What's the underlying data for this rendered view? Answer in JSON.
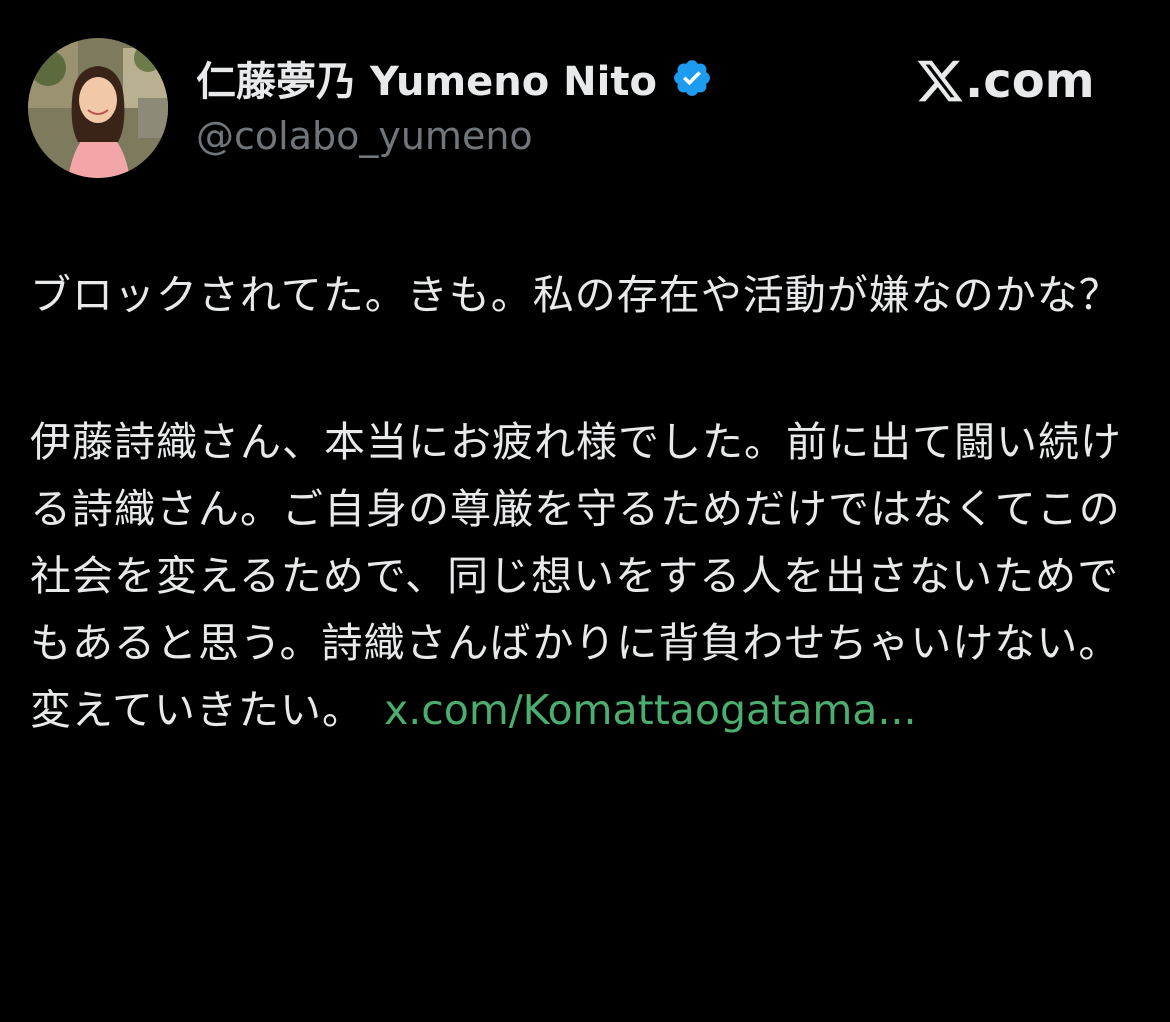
{
  "author": {
    "display_name": "仁藤夢乃 Yumeno Nito",
    "handle": "@colabo_yumeno",
    "verified": true,
    "verified_icon": "verified-badge-icon",
    "verified_color": "#1d9bf0"
  },
  "brand": {
    "logo_icon": "x-logo-icon",
    "text": ".com"
  },
  "tweet": {
    "paragraph_1": "ブロックされてた。きも。私の存在や活動が嫌なのかな？",
    "paragraph_2": "伊藤詩織さん、本当にお疲れ様でした。前に出て闘い続ける詩織さん。ご自身の尊厳を守るためだけではなくてこの社会を変えるためで、同じ想いをする人を出さないためでもあると思う。詩織さんばかりに背負わせちゃいけない。変えていきたい。",
    "link_text": "x.com/Komattaogatama..."
  },
  "colors": {
    "background": "#000000",
    "text": "#e7e9ea",
    "handle": "#71767b",
    "link": "#4bae6f"
  }
}
